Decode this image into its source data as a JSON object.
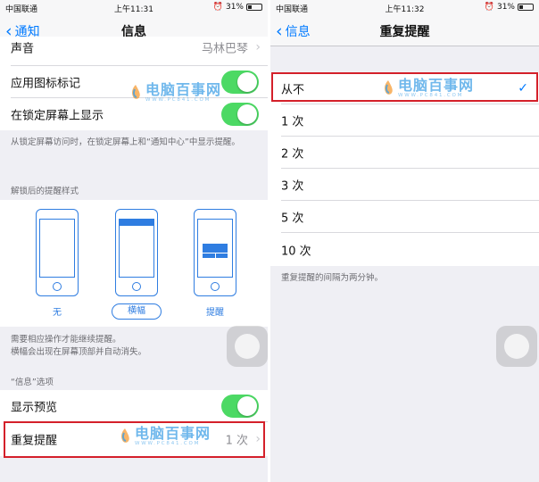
{
  "left": {
    "status": {
      "carrier": "中国联通",
      "time": "上午11:31",
      "battery": "31%",
      "battery_level": 0.31
    },
    "nav": {
      "back_label": "通知",
      "title": "信息"
    },
    "cells": {
      "sound_label": "声音",
      "sound_value": "马林巴琴",
      "badge_label": "应用图标标记",
      "lockscreen_label": "在锁定屏幕上显示",
      "lockscreen_note": "从锁定屏幕访问时，在锁定屏幕上和“通知中心”中显示提醒。"
    },
    "alert_style": {
      "header": "解锁后的提醒样式",
      "options": [
        {
          "label": "无",
          "selected": false
        },
        {
          "label": "横幅",
          "selected": true
        },
        {
          "label": "提醒",
          "selected": false
        }
      ],
      "note_line1": "需要相应操作才能继续提醒。",
      "note_line2": "横幅会出现在屏幕顶部并自动消失。"
    },
    "options_section": {
      "header": "“信息”选项",
      "preview_label": "显示预览",
      "repeat_label": "重复提醒",
      "repeat_value": "1 次"
    }
  },
  "right": {
    "status": {
      "carrier": "中国联通",
      "time": "上午11:32",
      "battery": "31%",
      "battery_level": 0.31
    },
    "nav": {
      "back_label": "信息",
      "title": "重复提醒"
    },
    "options": [
      {
        "label": "从不",
        "selected": true
      },
      {
        "label": "1 次",
        "selected": false
      },
      {
        "label": "2 次",
        "selected": false
      },
      {
        "label": "3 次",
        "selected": false
      },
      {
        "label": "5 次",
        "selected": false
      },
      {
        "label": "10 次",
        "selected": false
      }
    ],
    "footnote": "重复提醒的间隔为两分钟。"
  },
  "watermark": {
    "main": "电脑百事网",
    "sub": "WWW.PC841.COM"
  },
  "colors": {
    "accent": "#007aff",
    "toggle_on": "#4cd964",
    "highlight": "#d4202a",
    "style_blue": "#2f7de1"
  }
}
